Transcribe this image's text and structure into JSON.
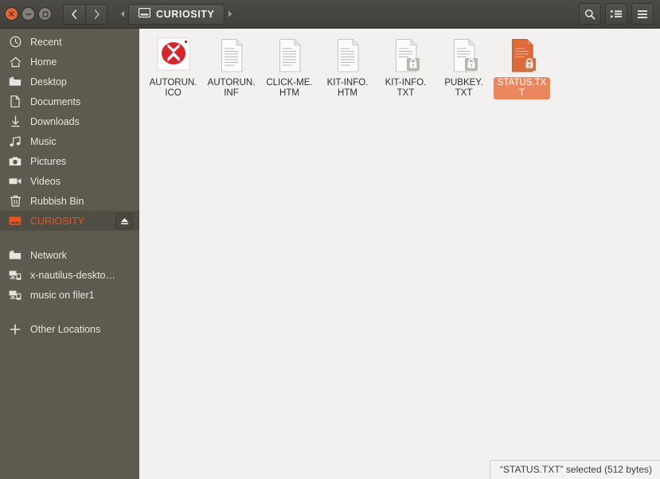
{
  "window": {
    "title": "CURIOSITY",
    "close_label": "Close",
    "minimize_label": "Minimize",
    "maximize_label": "Maximize"
  },
  "header": {
    "back_label": "Back",
    "forward_label": "Forward",
    "path_prev_label": "Previous path",
    "path_next_label": "Next path",
    "breadcrumb": {
      "icon": "drive-icon",
      "label": "CURIOSITY"
    },
    "buttons": [
      {
        "name": "search-button",
        "icon": "search-icon",
        "label": "Search"
      },
      {
        "name": "view-toggle-button",
        "icon": "list-view-icon",
        "label": "View options"
      },
      {
        "name": "menu-button",
        "icon": "hamburger-menu-icon",
        "label": "Menu"
      }
    ]
  },
  "sidebar": {
    "items": [
      {
        "icon": "clock-icon",
        "label": "Recent",
        "active": false,
        "eject": false
      },
      {
        "icon": "home-icon",
        "label": "Home",
        "active": false,
        "eject": false
      },
      {
        "icon": "folder-icon",
        "label": "Desktop",
        "active": false,
        "eject": false
      },
      {
        "icon": "document-icon",
        "label": "Documents",
        "active": false,
        "eject": false
      },
      {
        "icon": "download-icon",
        "label": "Downloads",
        "active": false,
        "eject": false
      },
      {
        "icon": "music-icon",
        "label": "Music",
        "active": false,
        "eject": false
      },
      {
        "icon": "camera-icon",
        "label": "Pictures",
        "active": false,
        "eject": false
      },
      {
        "icon": "video-icon",
        "label": "Videos",
        "active": false,
        "eject": false
      },
      {
        "icon": "trash-icon",
        "label": "Rubbish Bin",
        "active": false,
        "eject": false
      },
      {
        "icon": "drive-icon",
        "label": "CURIOSITY",
        "active": true,
        "eject": true
      }
    ],
    "network_items": [
      {
        "icon": "network-folder-icon",
        "label": "Network",
        "active": false,
        "eject": false
      },
      {
        "icon": "remote-share-icon",
        "label": "x-nautilus-deskto…",
        "active": false,
        "eject": false
      },
      {
        "icon": "remote-share-icon",
        "label": "music on filer1",
        "active": false,
        "eject": false
      },
      {
        "icon": "plus-icon",
        "label": "Other Locations",
        "active": false,
        "eject": false
      }
    ],
    "eject_label": "Eject"
  },
  "files": [
    {
      "name": "AUTORUN.ICO",
      "line1": "AUTORUN.",
      "line2": "ICO",
      "icon": "image-logo-icon",
      "locked": false,
      "selected": false
    },
    {
      "name": "AUTORUN.INF",
      "line1": "AUTORUN.",
      "line2": "INF",
      "icon": "text-file-icon",
      "locked": false,
      "selected": false
    },
    {
      "name": "CLICK-ME.HTM",
      "line1": "CLICK-ME.",
      "line2": "HTM",
      "icon": "text-file-icon",
      "locked": false,
      "selected": false
    },
    {
      "name": "KIT-INFO.HTM",
      "line1": "KIT-INFO.",
      "line2": "HTM",
      "icon": "text-file-icon",
      "locked": false,
      "selected": false
    },
    {
      "name": "KIT-INFO.TXT",
      "line1": "KIT-INFO.",
      "line2": "TXT",
      "icon": "text-file-icon",
      "locked": true,
      "selected": false
    },
    {
      "name": "PUBKEY.TXT",
      "line1": "PUBKEY.",
      "line2": "TXT",
      "icon": "text-file-icon",
      "locked": true,
      "selected": false
    },
    {
      "name": "STATUS.TXT",
      "line1": "STATUS.TXT",
      "line2": "",
      "icon": "text-file-icon",
      "locked": true,
      "selected": true
    }
  ],
  "statusbar": {
    "text": "“STATUS.TXT” selected  (512 bytes)"
  },
  "colors": {
    "titlebar": "#45433e",
    "sidebar": "#5d5b50",
    "content_bg": "#f2f1f0",
    "accent": "#e95420",
    "selection": "#e9875e",
    "close_button": "#e2663b",
    "logo_red": "#d6252b"
  }
}
